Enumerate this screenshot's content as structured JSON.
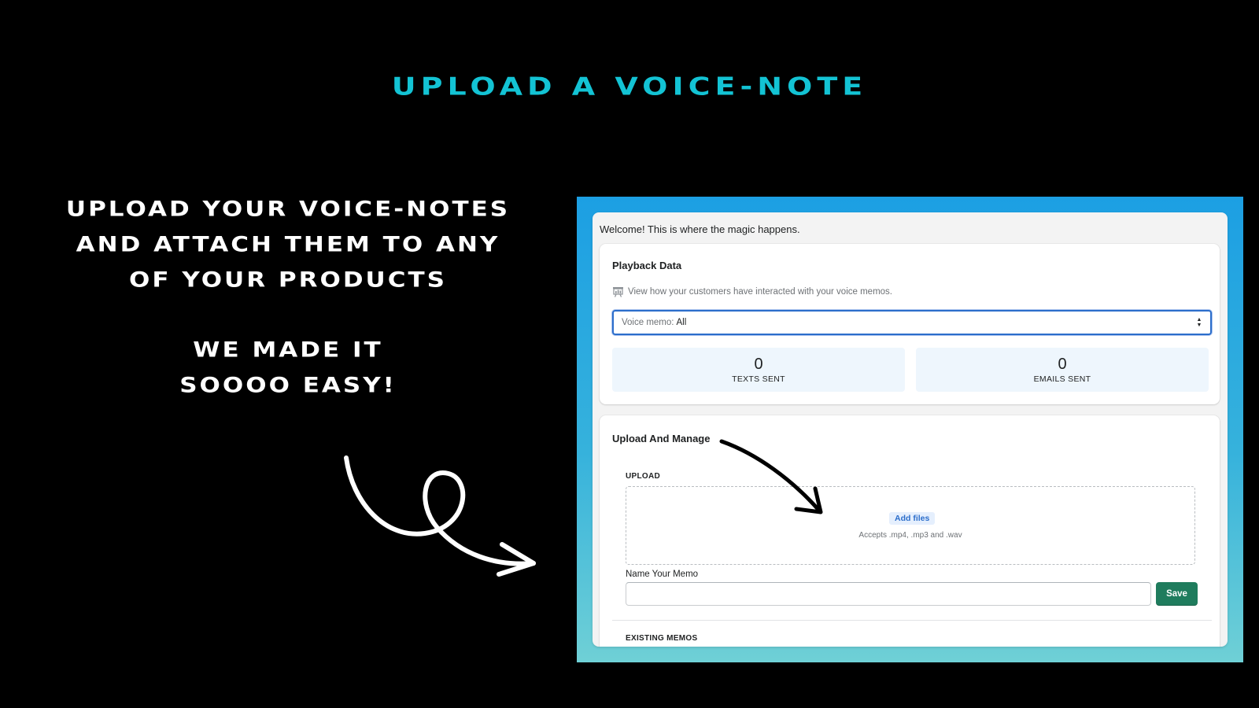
{
  "hero": {
    "title": "UPLOAD A VOICE-NOTE"
  },
  "promo": {
    "line1": "UPLOAD YOUR VOICE-NOTES",
    "line2": "AND ATTACH THEM TO ANY",
    "line3": "OF YOUR PRODUCTS",
    "line4": "WE MADE IT",
    "line5": "SOOOO EASY!"
  },
  "app": {
    "welcome": "Welcome! This is where the magic happens.",
    "playback": {
      "title": "Playback Data",
      "helper_icon": "presentation-chart-icon",
      "helper": "View how your customers have interacted with your voice memos.",
      "select_prefix": "Voice memo:",
      "select_value": "All",
      "stats": [
        {
          "value": "0",
          "label": "TEXTS SENT"
        },
        {
          "value": "0",
          "label": "EMAILS SENT"
        }
      ]
    },
    "upload": {
      "title": "Upload And Manage",
      "upload_label": "UPLOAD",
      "add_files": "Add files",
      "accepts": "Accepts .mp4, .mp3 and .wav",
      "name_label": "Name Your Memo",
      "name_value": "",
      "save": "Save",
      "existing_label": "EXISTING MEMOS"
    }
  },
  "colors": {
    "accent_title": "#13c3d4",
    "save_button": "#1f7c5d",
    "focus_blue": "#2c6ecb",
    "stat_bg": "#eef6fd"
  }
}
